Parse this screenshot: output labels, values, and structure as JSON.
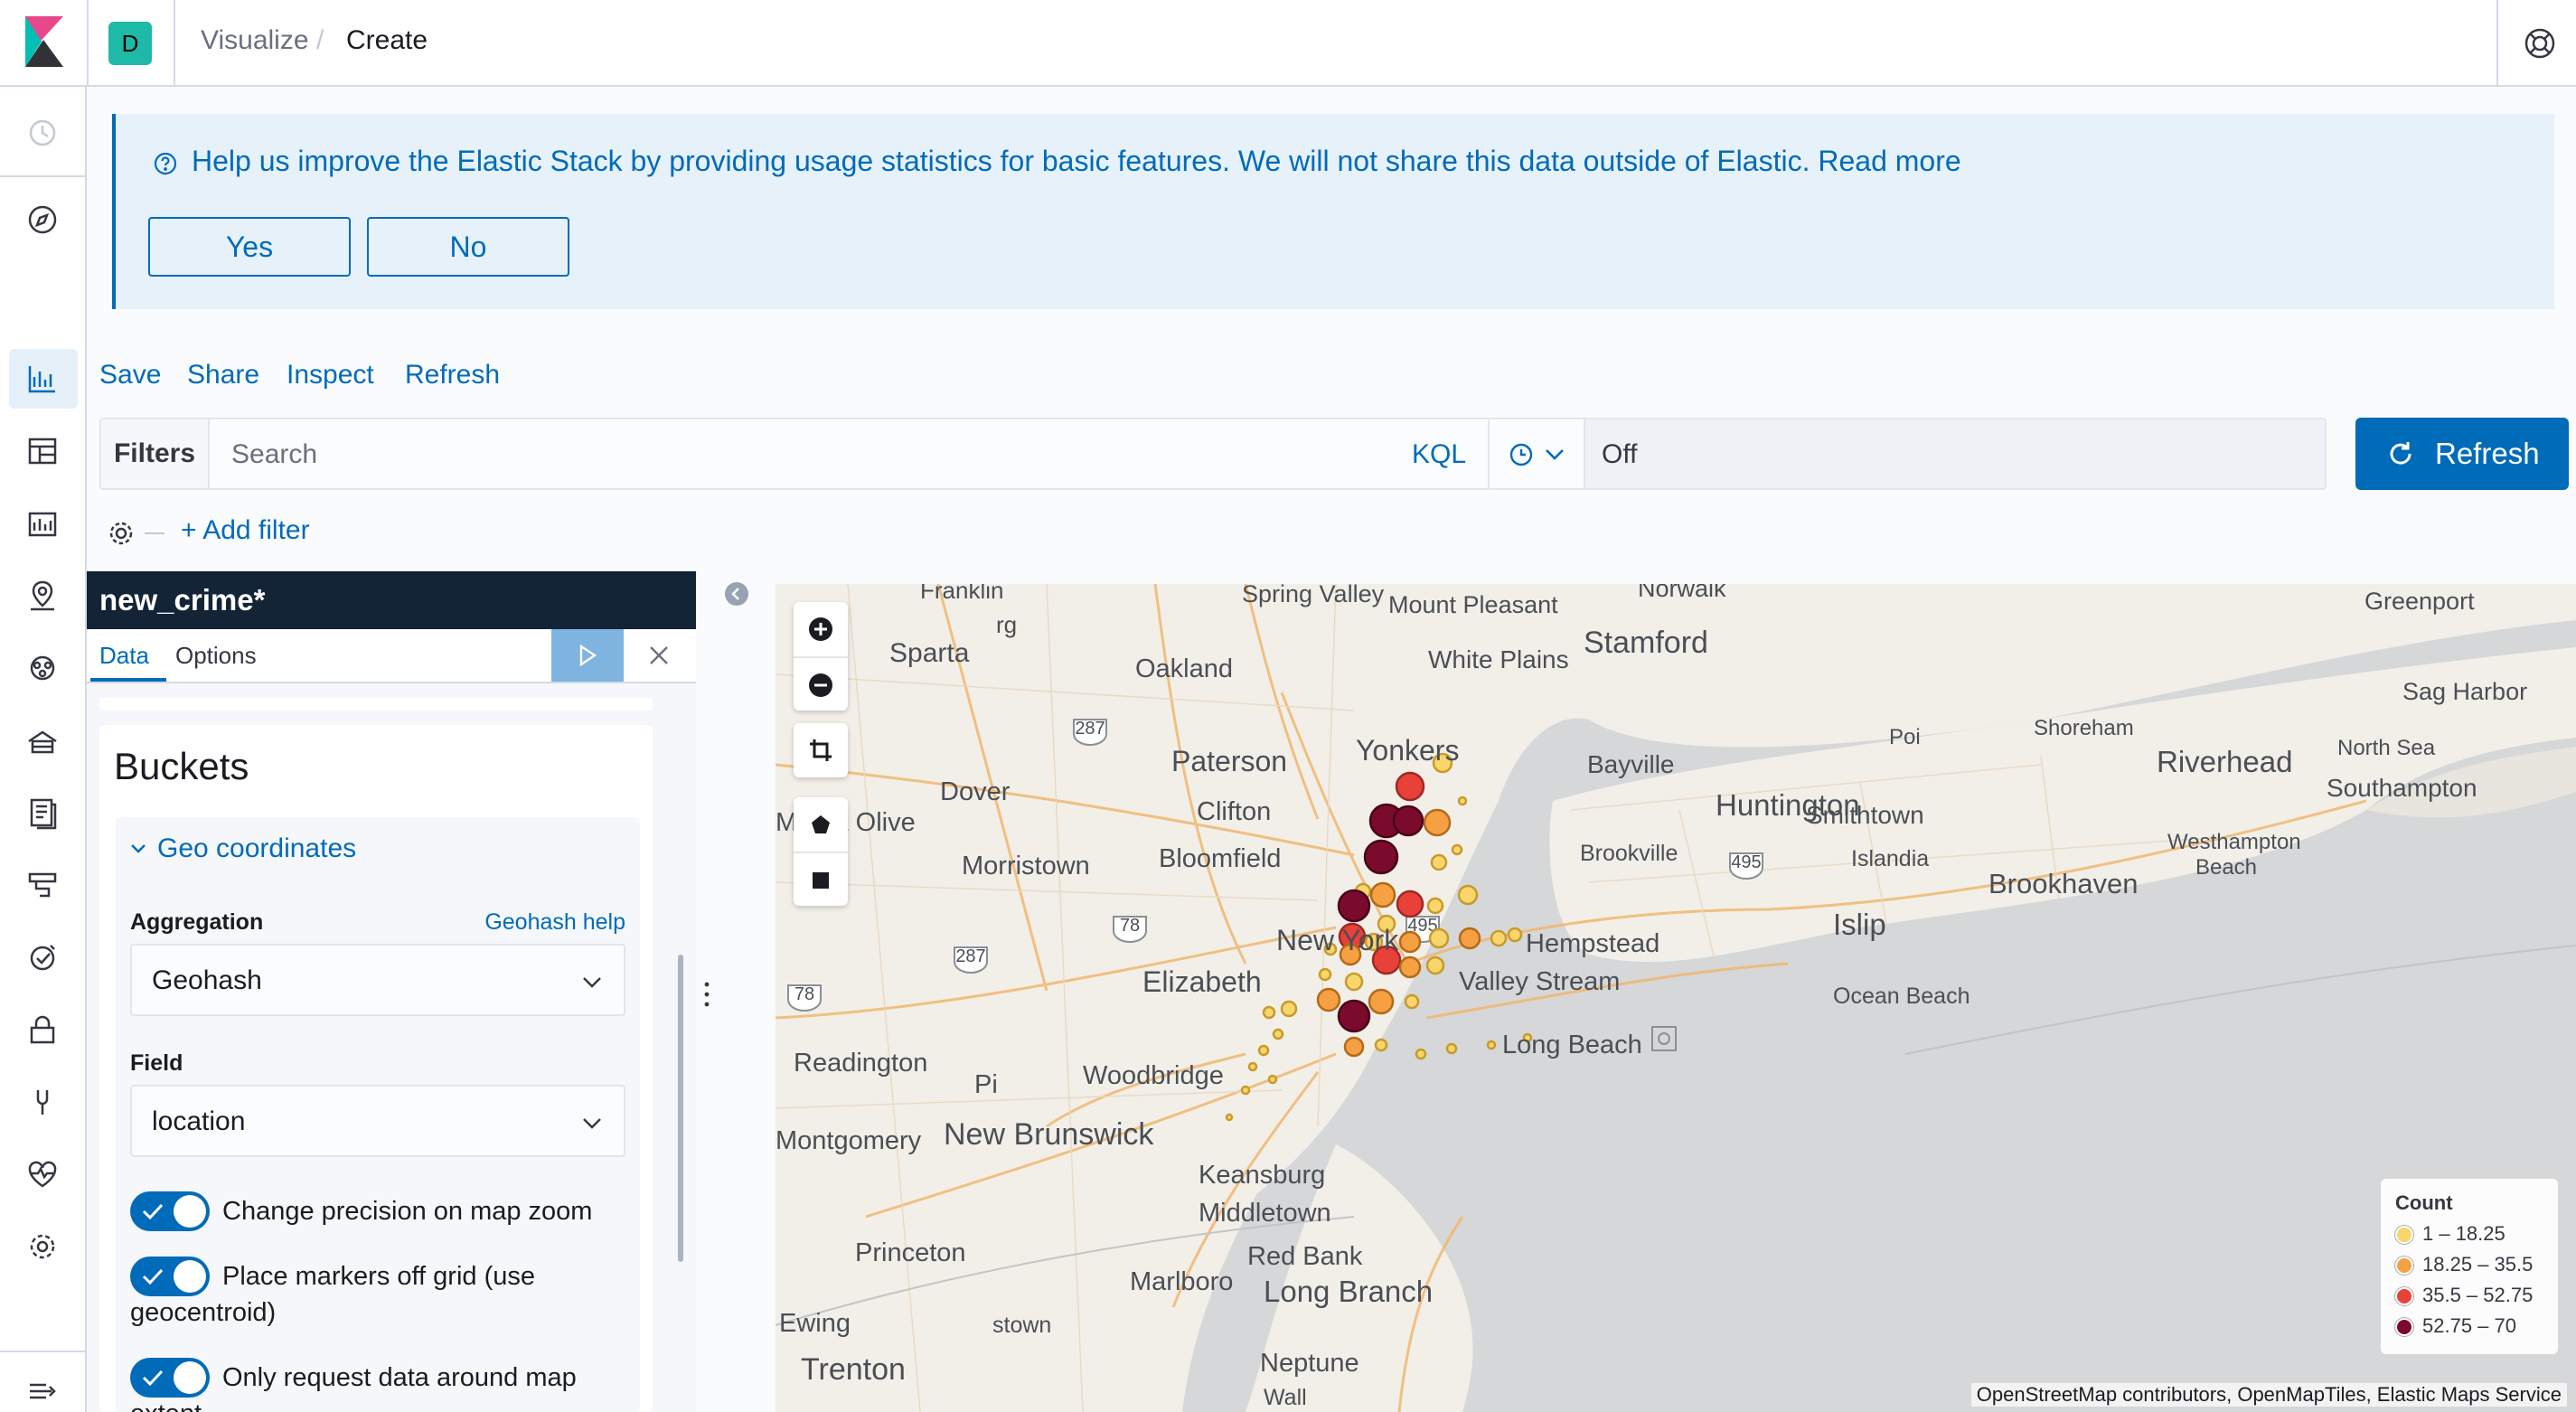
{
  "header": {
    "space_initial": "D",
    "breadcrumbs": [
      "Visualize",
      "Create"
    ],
    "breadcrumb_separator": "/"
  },
  "callout": {
    "message": "Help us improve the Elastic Stack by providing usage statistics for basic features. We will not share this data outside of Elastic. Read more",
    "yes_label": "Yes",
    "no_label": "No"
  },
  "top_menu": {
    "save": "Save",
    "share": "Share",
    "inspect": "Inspect",
    "refresh": "Refresh"
  },
  "query_bar": {
    "filters_label": "Filters",
    "search_placeholder": "Search",
    "language": "KQL",
    "refresh_interval": "Off",
    "refresh_button": "Refresh",
    "add_filter": "+ Add filter"
  },
  "editor": {
    "index_pattern": "new_crime*",
    "tabs": [
      "Data",
      "Options"
    ],
    "section_title": "Buckets",
    "bucket_type": "Geo coordinates",
    "aggregation_label": "Aggregation",
    "geohash_help": "Geohash help",
    "aggregation_value": "Geohash",
    "field_label": "Field",
    "field_value": "location",
    "toggles": [
      {
        "label": "Change precision on map zoom",
        "on": true
      },
      {
        "label": "Place markers off grid (use geocentroid)",
        "on": true
      },
      {
        "label": "Only request data around map extent",
        "on": true
      }
    ]
  },
  "map": {
    "place_labels": [
      "Spring Valley",
      "Mount Pleasant",
      "Norwalk",
      "Greenport",
      "Sparta",
      "Oakland",
      "White Plains",
      "Stamford",
      "Sag Harbor",
      "Shoreham",
      "Paterson",
      "Yonkers",
      "Bayville",
      "Riverhead",
      "North Sea",
      "Southampton",
      "Dover",
      "Clifton",
      "Huntington",
      "Smithtown",
      "Mount Olive",
      "Morristown",
      "Bloomfield",
      "Brookville",
      "Islandia",
      "Westhampton Beach",
      "Brookhaven",
      "New York",
      "Hempstead",
      "Islip",
      "Elizabeth",
      "Valley Stream",
      "Ocean Beach",
      "Readington",
      "Woodbridge",
      "Long Beach",
      "Montgomery",
      "New Brunswick",
      "Keansburg",
      "Middletown",
      "Red Bank",
      "Princeton",
      "Marlboro",
      "Long Branch",
      "Ewing",
      "Trenton",
      "Neptune",
      "rg",
      "Poi",
      "Franklin",
      "Pi",
      "stown",
      "Wall"
    ],
    "road_shields": [
      "287",
      "78",
      "287",
      "78",
      "495",
      "495"
    ],
    "attribution": "OpenStreetMap contributors, OpenMapTiles, Elastic Maps Service",
    "legend": {
      "title": "Count",
      "ranges": [
        {
          "label": "1 – 18.25",
          "color": "#f9d66b"
        },
        {
          "label": "18.25 – 35.5",
          "color": "#f5a043"
        },
        {
          "label": "35.5 – 52.75",
          "color": "#e8413a"
        },
        {
          "label": "52.75 – 70",
          "color": "#7a0b2c"
        }
      ]
    }
  },
  "colors": {
    "accent": "#006bb8",
    "panel_header": "#132437",
    "space_badge": "#1ebaa7"
  }
}
